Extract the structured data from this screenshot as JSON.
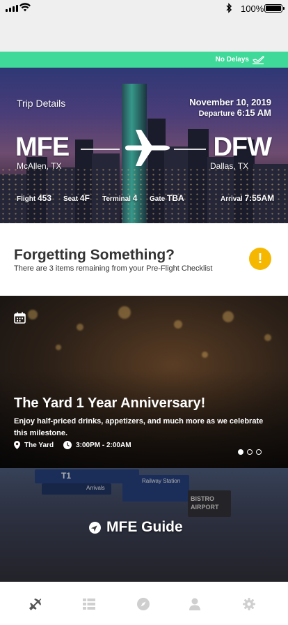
{
  "status_bar": {
    "battery_percent": "100%",
    "icons": [
      "signal-icon",
      "wifi-icon",
      "bluetooth-icon",
      "battery-icon"
    ]
  },
  "delay_strip": {
    "text": "No Delays",
    "color": "#3fd999",
    "icon": "plane-departure-icon"
  },
  "trip": {
    "section_label": "Trip Details",
    "date": "November 10,  2019",
    "departure_label": "Departure",
    "departure_time": "6:15 AM",
    "origin_code": "MFE",
    "origin_city": "McAllen, TX",
    "destination_code": "DFW",
    "destination_city": "Dallas, TX",
    "flight_label": "Flight",
    "flight_value": "453",
    "seat_label": "Seat",
    "seat_value": "4F",
    "terminal_label": "Terminal",
    "terminal_value": "4",
    "gate_label": "Gate",
    "gate_value": "TBA",
    "arrival_label": "Arrival",
    "arrival_value": "7:55AM"
  },
  "checklist": {
    "title": "Forgetting Something?",
    "subtitle": "There are 3 items remaining from your Pre-Flight Checklist",
    "alert_symbol": "!",
    "alert_color": "#f5b700"
  },
  "event": {
    "title": "The Yard 1 Year Anniversary!",
    "description": "Enjoy half-priced drinks, appetizers, and much more as we celebrate this milestone.",
    "location": "The Yard",
    "time": "3:00PM - 2:00AM",
    "carousel_active_index": 0,
    "carousel_count": 3
  },
  "guide": {
    "label": "MFE Guide",
    "sign_text": [
      "T1",
      "Arrivals",
      "Railway Station",
      "BISTRO AIRPORT"
    ]
  },
  "tabbar": {
    "tabs": [
      {
        "name": "flights",
        "icon": "plane-icon",
        "active": true
      },
      {
        "name": "checklist",
        "icon": "list-icon",
        "active": false
      },
      {
        "name": "explore",
        "icon": "compass-icon",
        "active": false
      },
      {
        "name": "profile",
        "icon": "user-icon",
        "active": false
      },
      {
        "name": "settings",
        "icon": "gear-icon",
        "active": false
      }
    ],
    "active_color": "#555555",
    "inactive_color": "#cfcfcf"
  }
}
